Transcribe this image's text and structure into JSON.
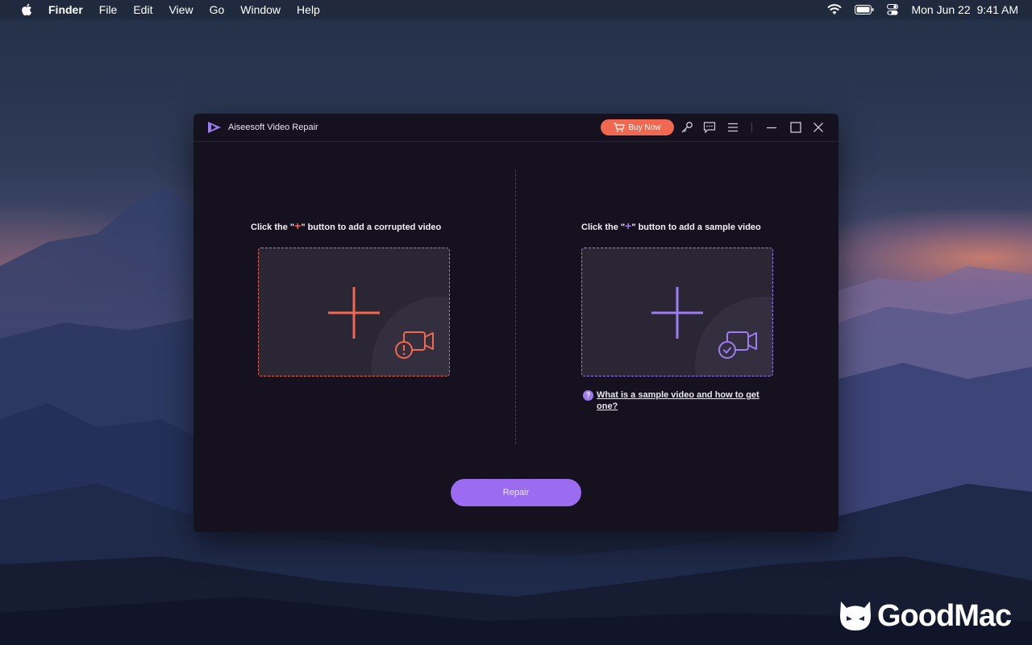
{
  "menubar": {
    "app": "Finder",
    "items": [
      "File",
      "Edit",
      "View",
      "Go",
      "Window",
      "Help"
    ],
    "date": "Mon Jun 22",
    "time": "9:41 AM",
    "icons": [
      "wifi-icon",
      "battery-icon",
      "control-center-icon"
    ]
  },
  "window": {
    "title": "Aiseesoft Video Repair",
    "buy_now": "Buy Now",
    "accent_color": "#9d7cf2",
    "buy_color": "#f0684f",
    "toolbar_icons": [
      "key-icon",
      "chat-icon",
      "menu-icon",
      "minimize-icon",
      "maximize-icon",
      "close-icon"
    ]
  },
  "left_panel": {
    "heading_prefix": "Click the \"",
    "heading_plus": "+",
    "heading_suffix": "\" button to add a corrupted video"
  },
  "right_panel": {
    "heading_prefix": "Click the \"",
    "heading_plus": "+",
    "heading_suffix": "\" button to add a sample video",
    "help_icon": "?",
    "help_link": "What is a sample video and how to get one?"
  },
  "repair_button": "Repair",
  "watermark": "GoodMac"
}
